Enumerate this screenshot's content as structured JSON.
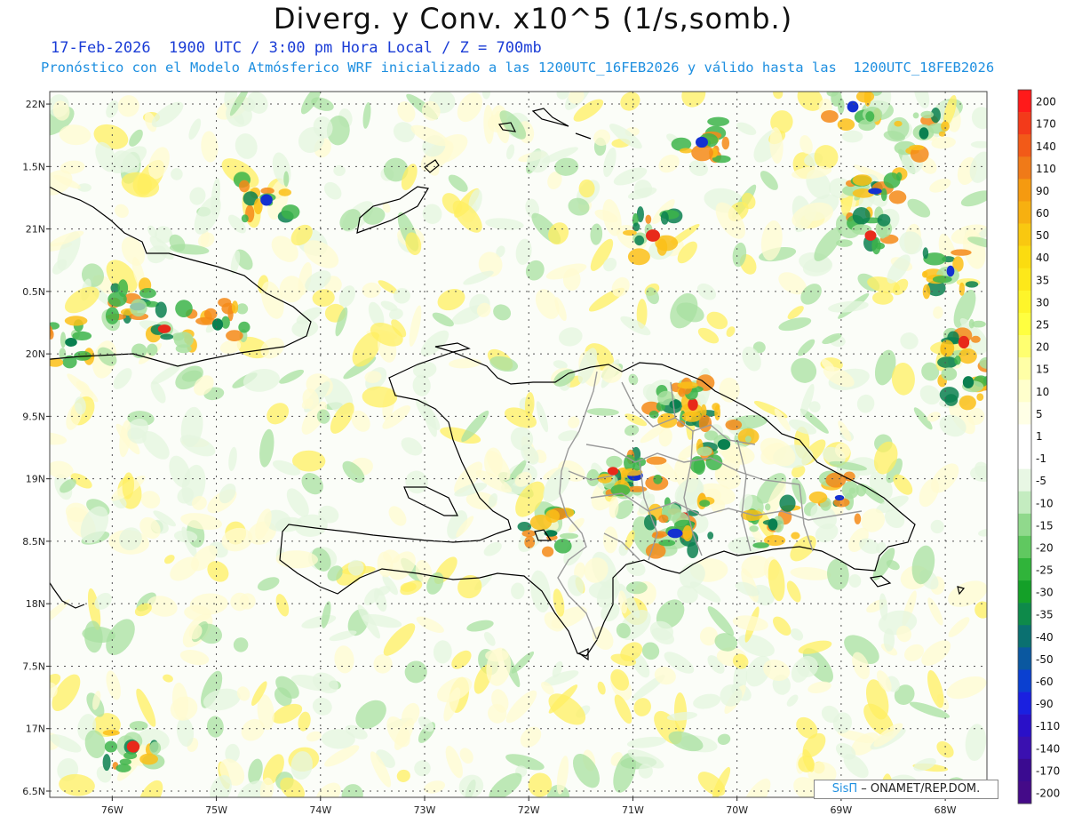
{
  "title": "Diverg. y Conv. x10^5 (1/s,somb.)",
  "subtitle_line1": "17-Feb-2026  1900 UTC / 3:00 pm Hora Local / Z = 700mb",
  "subtitle_line2": "Pronóstico con el Modelo Atmósferico WRF inicializado a las 1200UTC_16FEB2026 y válido hasta las  1200UTC_18FEB2026",
  "credit": {
    "brand": "SisΠ",
    "text": " – ONAMET/REP.DOM."
  },
  "lat_labels": [
    "22N",
    "1.5N",
    "21N",
    "0.5N",
    "20N",
    "9.5N",
    "19N",
    "8.5N",
    "18N",
    "7.5N",
    "17N",
    "6.5N"
  ],
  "lat_values": [
    22,
    21.5,
    21,
    20.5,
    20,
    19.5,
    19,
    18.5,
    18,
    17.5,
    17,
    16.5
  ],
  "lon_labels": [
    "76W",
    "75W",
    "74W",
    "73W",
    "72W",
    "71W",
    "70W",
    "69W",
    "68W"
  ],
  "lon_values": [
    -76,
    -75,
    -74,
    -73,
    -72,
    -71,
    -70,
    -69,
    -68
  ],
  "map_extent": {
    "lon_min": -76.6,
    "lon_max": -67.6,
    "lat_min": 16.45,
    "lat_max": 22.1
  },
  "colorbar": {
    "labels": [
      "200",
      "170",
      "140",
      "110",
      "90",
      "60",
      "50",
      "40",
      "35",
      "30",
      "25",
      "20",
      "15",
      "10",
      "5",
      "1",
      "-1",
      "-5",
      "-10",
      "-15",
      "-20",
      "-25",
      "-30",
      "-35",
      "-40",
      "-50",
      "-60",
      "-90",
      "-110",
      "-140",
      "-170",
      "-200"
    ],
    "colors": [
      "#ff1a1a",
      "#f33a1a",
      "#f25a18",
      "#f07a18",
      "#f59a10",
      "#f7b010",
      "#f9c810",
      "#fbdc10",
      "#fde81a",
      "#fef52a",
      "#ffff40",
      "#ffff70",
      "#ffffa6",
      "#ffffcc",
      "#ffffe6",
      "#ffffff",
      "#ffffff",
      "#e8f7e4",
      "#c4ecc0",
      "#90d98c",
      "#60c860",
      "#30b43a",
      "#14a028",
      "#0e8a4a",
      "#0a7070",
      "#0a58a0",
      "#0a40d0",
      "#1a20e0",
      "#2a10c8",
      "#3a10b0",
      "#3a0a90",
      "#440a88"
    ]
  },
  "field_colors": {
    "conv_light": "#e4f5df",
    "conv_mid": "#a8e0a0",
    "conv_strong": "#3cb44a",
    "conv_deep": "#0a8050",
    "conv_blue": "#1430d0",
    "div_light": "#fffbd0",
    "div_mid": "#ffef60",
    "div_strong": "#fcbf18",
    "div_orange": "#f58a18",
    "div_red": "#e82a1a"
  }
}
